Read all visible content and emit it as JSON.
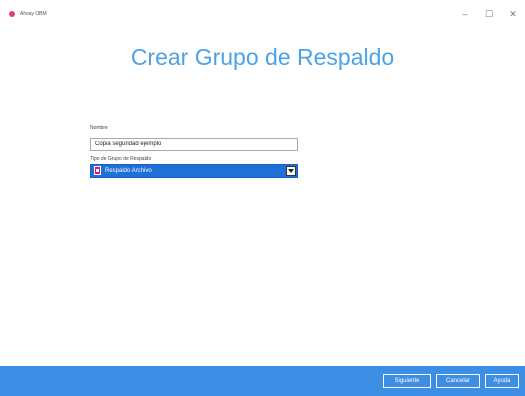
{
  "window": {
    "title": "Ahsay OBM",
    "controls": {
      "minimize": "–",
      "maximize": "☐",
      "close": "✕"
    }
  },
  "page": {
    "title": "Crear Grupo de Respaldo"
  },
  "form": {
    "name_label": "Nombre",
    "name_value": "Copia seguridad ejemplo",
    "type_label": "Tipo de Grupo de Respaldo",
    "type_value": "Respaldo Archivo",
    "type_icon": "file-backup-icon"
  },
  "footer": {
    "next_label": "Siguiente",
    "cancel_label": "Cancelar",
    "help_label": "Ayuda"
  },
  "colors": {
    "title_blue": "#4da2e6",
    "select_blue": "#1e6fd6",
    "footer_blue": "#3d8fe6",
    "icon_magenta": "#d6187a"
  }
}
